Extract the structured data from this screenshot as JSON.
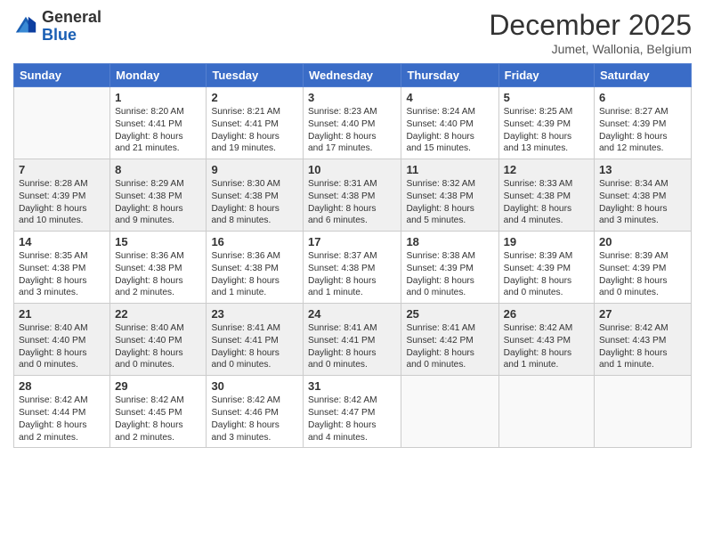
{
  "logo": {
    "text_general": "General",
    "text_blue": "Blue"
  },
  "header": {
    "month_title": "December 2025",
    "subtitle": "Jumet, Wallonia, Belgium"
  },
  "days_of_week": [
    "Sunday",
    "Monday",
    "Tuesday",
    "Wednesday",
    "Thursday",
    "Friday",
    "Saturday"
  ],
  "weeks": [
    [
      {
        "num": "",
        "info": ""
      },
      {
        "num": "1",
        "info": "Sunrise: 8:20 AM\nSunset: 4:41 PM\nDaylight: 8 hours\nand 21 minutes."
      },
      {
        "num": "2",
        "info": "Sunrise: 8:21 AM\nSunset: 4:41 PM\nDaylight: 8 hours\nand 19 minutes."
      },
      {
        "num": "3",
        "info": "Sunrise: 8:23 AM\nSunset: 4:40 PM\nDaylight: 8 hours\nand 17 minutes."
      },
      {
        "num": "4",
        "info": "Sunrise: 8:24 AM\nSunset: 4:40 PM\nDaylight: 8 hours\nand 15 minutes."
      },
      {
        "num": "5",
        "info": "Sunrise: 8:25 AM\nSunset: 4:39 PM\nDaylight: 8 hours\nand 13 minutes."
      },
      {
        "num": "6",
        "info": "Sunrise: 8:27 AM\nSunset: 4:39 PM\nDaylight: 8 hours\nand 12 minutes."
      }
    ],
    [
      {
        "num": "7",
        "info": "Sunrise: 8:28 AM\nSunset: 4:39 PM\nDaylight: 8 hours\nand 10 minutes."
      },
      {
        "num": "8",
        "info": "Sunrise: 8:29 AM\nSunset: 4:38 PM\nDaylight: 8 hours\nand 9 minutes."
      },
      {
        "num": "9",
        "info": "Sunrise: 8:30 AM\nSunset: 4:38 PM\nDaylight: 8 hours\nand 8 minutes."
      },
      {
        "num": "10",
        "info": "Sunrise: 8:31 AM\nSunset: 4:38 PM\nDaylight: 8 hours\nand 6 minutes."
      },
      {
        "num": "11",
        "info": "Sunrise: 8:32 AM\nSunset: 4:38 PM\nDaylight: 8 hours\nand 5 minutes."
      },
      {
        "num": "12",
        "info": "Sunrise: 8:33 AM\nSunset: 4:38 PM\nDaylight: 8 hours\nand 4 minutes."
      },
      {
        "num": "13",
        "info": "Sunrise: 8:34 AM\nSunset: 4:38 PM\nDaylight: 8 hours\nand 3 minutes."
      }
    ],
    [
      {
        "num": "14",
        "info": "Sunrise: 8:35 AM\nSunset: 4:38 PM\nDaylight: 8 hours\nand 3 minutes."
      },
      {
        "num": "15",
        "info": "Sunrise: 8:36 AM\nSunset: 4:38 PM\nDaylight: 8 hours\nand 2 minutes."
      },
      {
        "num": "16",
        "info": "Sunrise: 8:36 AM\nSunset: 4:38 PM\nDaylight: 8 hours\nand 1 minute."
      },
      {
        "num": "17",
        "info": "Sunrise: 8:37 AM\nSunset: 4:38 PM\nDaylight: 8 hours\nand 1 minute."
      },
      {
        "num": "18",
        "info": "Sunrise: 8:38 AM\nSunset: 4:39 PM\nDaylight: 8 hours\nand 0 minutes."
      },
      {
        "num": "19",
        "info": "Sunrise: 8:39 AM\nSunset: 4:39 PM\nDaylight: 8 hours\nand 0 minutes."
      },
      {
        "num": "20",
        "info": "Sunrise: 8:39 AM\nSunset: 4:39 PM\nDaylight: 8 hours\nand 0 minutes."
      }
    ],
    [
      {
        "num": "21",
        "info": "Sunrise: 8:40 AM\nSunset: 4:40 PM\nDaylight: 8 hours\nand 0 minutes."
      },
      {
        "num": "22",
        "info": "Sunrise: 8:40 AM\nSunset: 4:40 PM\nDaylight: 8 hours\nand 0 minutes."
      },
      {
        "num": "23",
        "info": "Sunrise: 8:41 AM\nSunset: 4:41 PM\nDaylight: 8 hours\nand 0 minutes."
      },
      {
        "num": "24",
        "info": "Sunrise: 8:41 AM\nSunset: 4:41 PM\nDaylight: 8 hours\nand 0 minutes."
      },
      {
        "num": "25",
        "info": "Sunrise: 8:41 AM\nSunset: 4:42 PM\nDaylight: 8 hours\nand 0 minutes."
      },
      {
        "num": "26",
        "info": "Sunrise: 8:42 AM\nSunset: 4:43 PM\nDaylight: 8 hours\nand 1 minute."
      },
      {
        "num": "27",
        "info": "Sunrise: 8:42 AM\nSunset: 4:43 PM\nDaylight: 8 hours\nand 1 minute."
      }
    ],
    [
      {
        "num": "28",
        "info": "Sunrise: 8:42 AM\nSunset: 4:44 PM\nDaylight: 8 hours\nand 2 minutes."
      },
      {
        "num": "29",
        "info": "Sunrise: 8:42 AM\nSunset: 4:45 PM\nDaylight: 8 hours\nand 2 minutes."
      },
      {
        "num": "30",
        "info": "Sunrise: 8:42 AM\nSunset: 4:46 PM\nDaylight: 8 hours\nand 3 minutes."
      },
      {
        "num": "31",
        "info": "Sunrise: 8:42 AM\nSunset: 4:47 PM\nDaylight: 8 hours\nand 4 minutes."
      },
      {
        "num": "",
        "info": ""
      },
      {
        "num": "",
        "info": ""
      },
      {
        "num": "",
        "info": ""
      }
    ]
  ]
}
